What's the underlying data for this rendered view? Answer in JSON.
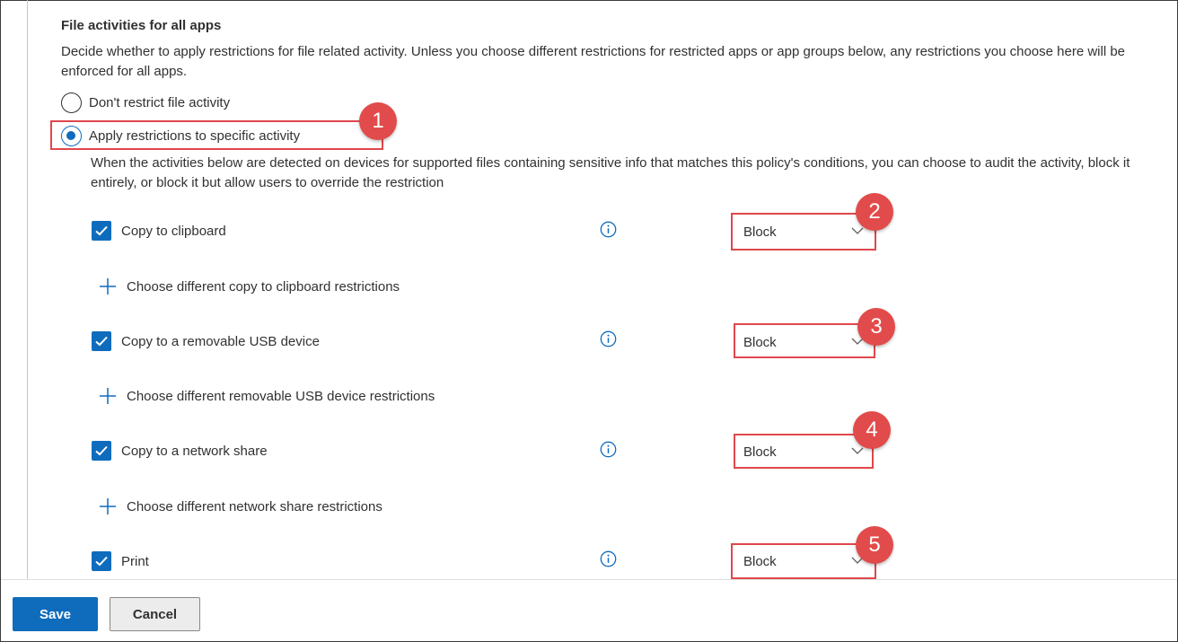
{
  "section": {
    "title": "File activities for all apps",
    "description": "Decide whether to apply restrictions for file related activity. Unless you choose different restrictions for restricted apps or app groups below, any restrictions you choose here will be enforced for all apps."
  },
  "radios": [
    {
      "label": "Don't restrict file activity",
      "checked": false
    },
    {
      "label": "Apply restrictions to specific activity",
      "checked": true
    }
  ],
  "activity_description": "When the activities below are detected on devices for supported files containing sensitive info that matches this policy's conditions, you can choose to audit the activity, block it entirely, or block it but allow users to override the restriction",
  "activities": [
    {
      "label": "Copy to clipboard",
      "checked": true,
      "action": "Block",
      "add_link": "Choose different copy to clipboard restrictions",
      "callout": "2"
    },
    {
      "label": "Copy to a removable USB device",
      "checked": true,
      "action": "Block",
      "add_link": "Choose different removable USB device restrictions",
      "callout": "3"
    },
    {
      "label": "Copy to a network share",
      "checked": true,
      "action": "Block",
      "add_link": "Choose different network share restrictions",
      "callout": "4"
    },
    {
      "label": "Print",
      "checked": true,
      "action": "Block",
      "callout": "5"
    }
  ],
  "callouts": {
    "radio": "1"
  },
  "footer": {
    "save_label": "Save",
    "cancel_label": "Cancel"
  },
  "colors": {
    "accent": "#0f6cbd",
    "highlight": "#e0474c",
    "badge": "#e24b4b"
  },
  "icons": [
    "radio-button",
    "checkbox-checked",
    "info-icon",
    "chevron-down-icon",
    "plus-icon"
  ]
}
